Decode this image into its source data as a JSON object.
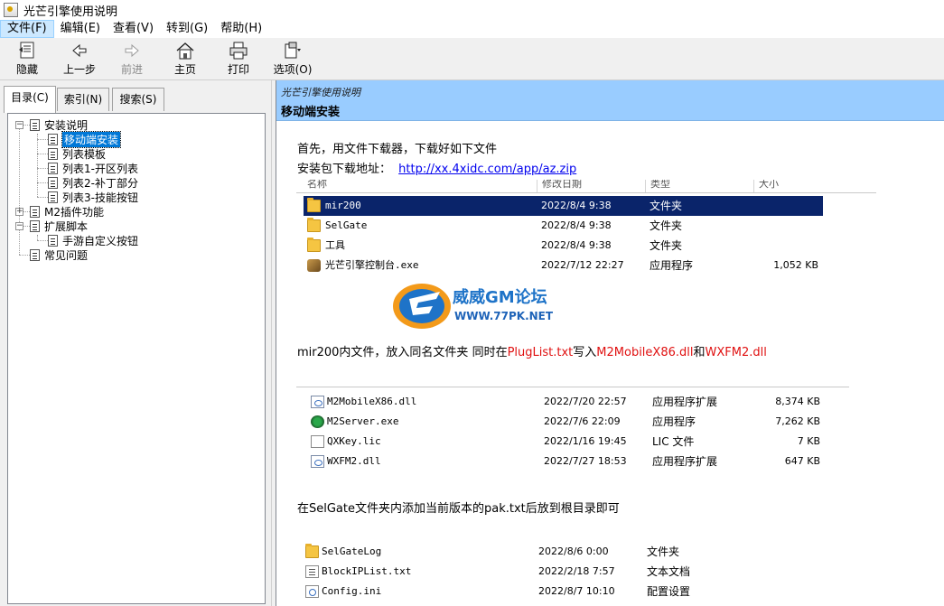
{
  "window": {
    "title": "光芒引擎使用说明"
  },
  "menu": [
    {
      "label": "文件(F)",
      "active": true
    },
    {
      "label": "编辑(E)"
    },
    {
      "label": "查看(V)"
    },
    {
      "label": "转到(G)"
    },
    {
      "label": "帮助(H)"
    }
  ],
  "toolbar": {
    "hide": "隐藏",
    "back": "上一步",
    "forward": "前进",
    "home": "主页",
    "print": "打印",
    "options": "选项(O)"
  },
  "tabs": {
    "contents": "目录(C)",
    "index": "索引(N)",
    "search": "搜索(S)"
  },
  "tree": {
    "install": "安装说明",
    "mobile": "移动端安装",
    "list_template": "列表模板",
    "list1": "列表1-开区列表",
    "list2": "列表2-补丁部分",
    "list3": "列表3-技能按钮",
    "m2plugin": "M2插件功能",
    "extscript": "扩展脚本",
    "mobile_button": "手游自定义按钮",
    "faq": "常见问题"
  },
  "content": {
    "breadcrumb": "光芒引擎使用说明",
    "title": "移动端安装",
    "p1": "首先，用文件下载器，下载好如下文件",
    "p2_label": "安装包下载地址：",
    "p2_link": "http://xx.4xidc.com/app/az.zip",
    "p3_a": "mir200内文件，放入同名文件夹 同时在",
    "p3_b": "PlugList.txt",
    "p3_c": "写入",
    "p3_d": "M2MobileX86.dll",
    "p3_e": "和",
    "p3_f": "WXFM2.dll",
    "p4": "在SelGate文件夹内添加当前版本的pak.txt后放到根目录即可"
  },
  "explorer1": {
    "headers": [
      "名称",
      "修改日期",
      "类型",
      "大小"
    ],
    "rows": [
      {
        "name": "mir200",
        "date": "2022/8/4 9:38",
        "type": "文件夹",
        "size": "",
        "icon": "folder-icon"
      },
      {
        "name": "SelGate",
        "date": "2022/8/4 9:38",
        "type": "文件夹",
        "size": "",
        "icon": "folder-icon"
      },
      {
        "name": "工具",
        "date": "2022/8/4 9:38",
        "type": "文件夹",
        "size": "",
        "icon": "folder-icon"
      },
      {
        "name": "光芒引擎控制台.exe",
        "date": "2022/7/12 22:27",
        "type": "应用程序",
        "size": "1,052 KB",
        "icon": "exe-icon"
      }
    ]
  },
  "explorer2": {
    "rows": [
      {
        "name": "M2MobileX86.dll",
        "date": "2022/7/20 22:57",
        "type": "应用程序扩展",
        "size": "8,374 KB",
        "icon": "dll-icon"
      },
      {
        "name": "M2Server.exe",
        "date": "2022/7/6 22:09",
        "type": "应用程序",
        "size": "7,262 KB",
        "icon": "server-icon"
      },
      {
        "name": "QXKey.lic",
        "date": "2022/1/16 19:45",
        "type": "LIC 文件",
        "size": "7 KB",
        "icon": "file-icon"
      },
      {
        "name": "WXFM2.dll",
        "date": "2022/7/27 18:53",
        "type": "应用程序扩展",
        "size": "647 KB",
        "icon": "dll-icon"
      }
    ]
  },
  "explorer3": {
    "rows": [
      {
        "name": "SelGateLog",
        "date": "2022/8/6 0:00",
        "type": "文件夹",
        "icon": "folder-icon"
      },
      {
        "name": "BlockIPList.txt",
        "date": "2022/2/18 7:57",
        "type": "文本文档",
        "icon": "txt-icon"
      },
      {
        "name": "Config.ini",
        "date": "2022/8/7 10:10",
        "type": "配置设置",
        "icon": "ini-icon"
      }
    ]
  },
  "watermark": {
    "line1": "威威GM论坛",
    "line2": "WWW.77PK.NET"
  }
}
